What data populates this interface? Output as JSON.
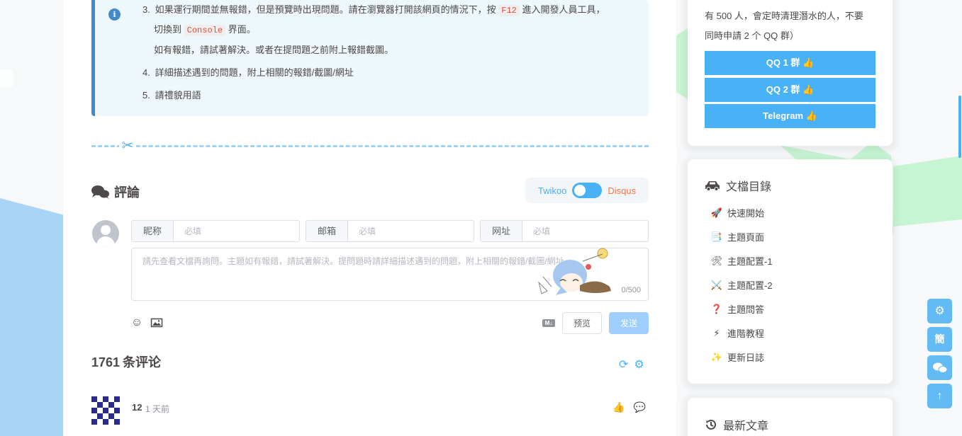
{
  "note": {
    "items": [
      {
        "num": "3.",
        "pre": "如果運行期間並無報錯，但是預覽時出現問題。請在瀏覽器打開該網頁的情況下，按",
        "code": "F12",
        "post": "進入開發人員工具，"
      },
      {
        "cont_pre": "切換到",
        "code": "Console",
        "cont_post": "界面。"
      },
      {
        "cont": "如有報錯，請試著解決。或者在提問題之前附上報錯截圖。"
      },
      {
        "num": "4.",
        "text": "詳細描述遇到的問題，附上相關的報錯/截圖/網址"
      },
      {
        "num": "5.",
        "text": "請禮貌用語"
      }
    ]
  },
  "comments": {
    "title": "評論",
    "switch_left": "Twikoo",
    "switch_right": "Disqus",
    "fields": [
      {
        "label": "昵称",
        "placeholder": "必填"
      },
      {
        "label": "邮箱",
        "placeholder": "必填"
      },
      {
        "label": "网址",
        "placeholder": "必填"
      }
    ],
    "textarea_placeholder": "請先查看文檔再詢問。主題如有報錯，請試著解決。提問題時請詳細描述遇到的問題，附上相關的報錯/截圖/網址。",
    "word_count": "0/500",
    "preview_btn": "预览",
    "send_btn": "发送",
    "md_badge": "M↓",
    "count": "1761",
    "count_suffix": "条评论",
    "first": {
      "nick": "12",
      "time": "1 天前"
    }
  },
  "sidebar": {
    "group_text_1": "有 500 人，會定時清理潛水的人，不要",
    "group_text_2": "同時申請 2 个 QQ 群）",
    "group_buttons": [
      "QQ 1 群 👍",
      "QQ 2 群 👍",
      "Telegram 👍"
    ],
    "docs_title": "文檔目錄",
    "docs": [
      {
        "emoji": "🚀",
        "label": "快速開始"
      },
      {
        "emoji": "📑",
        "label": "主題頁面"
      },
      {
        "emoji": "🛠",
        "label": "主題配置-1"
      },
      {
        "emoji": "⚔️",
        "label": "主題配置-2"
      },
      {
        "emoji": "❓",
        "label": "主題問答"
      },
      {
        "emoji": "⚡",
        "label": "進階教程"
      },
      {
        "emoji": "✨",
        "label": "更新日誌"
      }
    ],
    "recent_title": "最新文章"
  },
  "rightside": {
    "lang_btn": "簡"
  },
  "colors": {
    "accent": "#49b1f5",
    "note_border": "#428bca",
    "note_bg": "#eef7fb",
    "code": "#e74c3c"
  }
}
